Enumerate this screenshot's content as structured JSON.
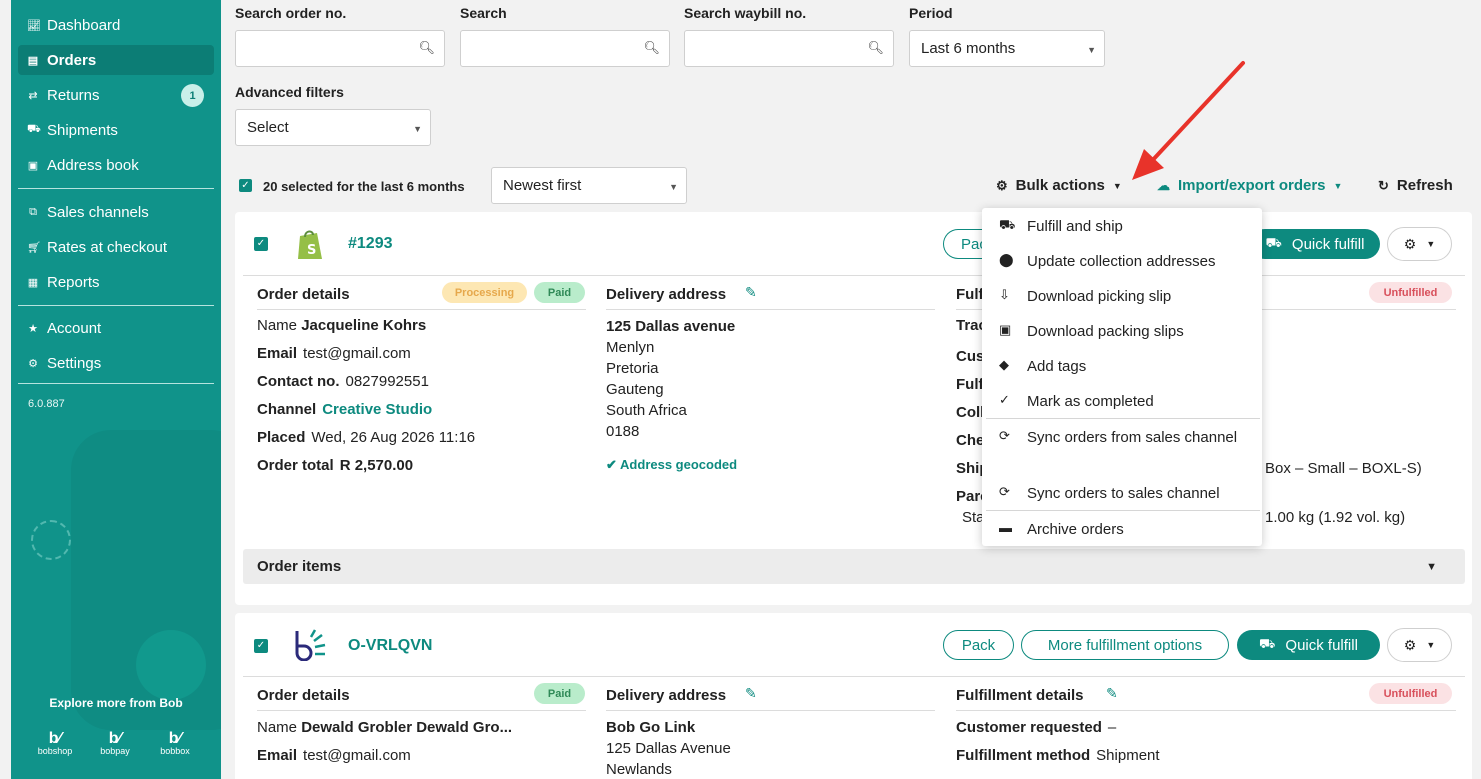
{
  "sidebar": {
    "nav": [
      {
        "label": "Dashboard",
        "icon": "chart-icon"
      },
      {
        "label": "Orders",
        "icon": "orders-icon",
        "active": true
      },
      {
        "label": "Returns",
        "icon": "returns-icon",
        "badge": "1"
      },
      {
        "label": "Shipments",
        "icon": "truck-icon"
      },
      {
        "label": "Address book",
        "icon": "addressbook-icon"
      },
      {
        "label": "Sales channels",
        "icon": "channels-icon"
      },
      {
        "label": "Rates at checkout",
        "icon": "cart-icon"
      },
      {
        "label": "Reports",
        "icon": "report-icon"
      },
      {
        "label": "Account",
        "icon": "star-icon"
      },
      {
        "label": "Settings",
        "icon": "gear-icon"
      }
    ],
    "version": "6.0.887",
    "explore": "Explore more from Bob",
    "brands": [
      "bobshop",
      "bobpay",
      "bobbox"
    ]
  },
  "filters": {
    "order_label": "Search order no.",
    "search_label": "Search",
    "waybill_label": "Search waybill no.",
    "period_label": "Period",
    "period_value": "Last 6 months",
    "advanced_label": "Advanced filters",
    "advanced_value": "Select"
  },
  "toolbar": {
    "selected_text": "20 selected for the last 6 months",
    "sort_value": "Newest first",
    "bulk_actions": "Bulk actions",
    "import_export": "Import/export orders",
    "refresh": "Refresh"
  },
  "bulk_menu": [
    {
      "label": "Fulfill and ship",
      "icon": "truck-icon"
    },
    {
      "label": "Update collection addresses",
      "icon": "pin-icon"
    },
    {
      "label": "Download picking slip",
      "icon": "download-file-icon"
    },
    {
      "label": "Download packing slips",
      "icon": "box-icon"
    },
    {
      "label": "Add tags",
      "icon": "tag-icon"
    },
    {
      "label": "Mark as completed",
      "icon": "check-icon"
    },
    {
      "label": "Sync orders from sales channel",
      "icon": "sync-icon"
    },
    {
      "label": "Sync orders to sales channel",
      "icon": "sync-icon"
    },
    {
      "label": "Archive orders",
      "icon": "archive-icon"
    }
  ],
  "order1": {
    "number": "#1293",
    "pack": "Pac",
    "quick_fulfill": "Quick fulfill",
    "details_header": "Order details",
    "status_processing": "Processing",
    "status_paid": "Paid",
    "delivery_header": "Delivery address",
    "fulfillment_header": "Fulf",
    "status_unfulfilled": "Unfulfilled",
    "name_label": "Name",
    "name": "Jacqueline Kohrs",
    "email_label": "Email",
    "email": "test@gmail.com",
    "contact_label": "Contact no.",
    "contact": "0827992551",
    "channel_label": "Channel",
    "channel": "Creative Studio",
    "placed_label": "Placed",
    "placed": "Wed, 26 Aug 2026 11:16",
    "total_label": "Order total",
    "total": "R 2,570.00",
    "address_line1": "125 Dallas avenue",
    "address_lines": [
      "Menlyn",
      "Pretoria",
      "Gauteng",
      "South Africa",
      "0188"
    ],
    "geocoded": "Address geocoded",
    "fulfill_partial": [
      "Trac",
      "Cus",
      "Fulf",
      "Coll",
      "Che",
      "Ship",
      "Parc",
      "Sta"
    ],
    "box_text": "Box – Small – BOXL-S)",
    "weight_text": "1.00 kg (1.92 vol. kg)",
    "order_items": "Order items"
  },
  "order2": {
    "number": "O-VRLQVN",
    "pack": "Pack",
    "more_options": "More fulfillment options",
    "quick_fulfill": "Quick fulfill",
    "details_header": "Order details",
    "status_paid": "Paid",
    "delivery_header": "Delivery address",
    "fulfillment_header": "Fulfillment details",
    "status_unfulfilled": "Unfulfilled",
    "name_label": "Name",
    "name": "Dewald Grobler Dewald Gro...",
    "email_label": "Email",
    "email": "test@gmail.com",
    "address_line1": "Bob Go Link",
    "address_lines": [
      "125 Dallas Avenue",
      "Newlands"
    ],
    "cust_req_label": "Customer requested",
    "cust_req": "–",
    "method_label": "Fulfillment method",
    "method": "Shipment"
  },
  "colors": {
    "brand": "#10938a",
    "accent": "#0d8a7f",
    "arrow": "#e8332a"
  }
}
